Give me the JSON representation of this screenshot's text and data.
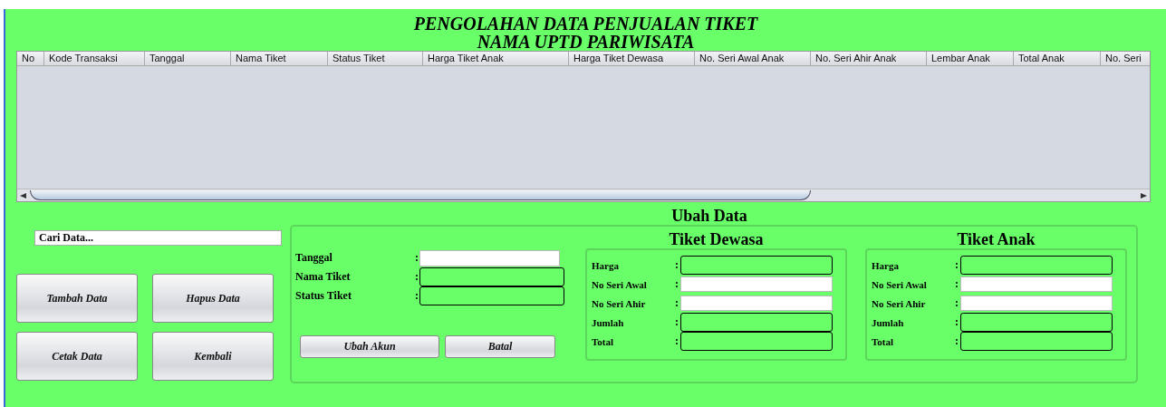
{
  "title_lines": [
    "PENGOLAHAN DATA PENJUALAN TIKET",
    "NAMA UPTD PARIWISATA"
  ],
  "table": {
    "columns": [
      "No",
      "Kode Transaksi",
      "Tanggal",
      "Nama Tiket",
      "Status Tiket",
      "Harga Tiket Anak",
      "Harga Tiket Dewasa",
      "No. Seri Awal Anak",
      "No. Seri Ahir Anak",
      "Lembar Anak",
      "Total Anak",
      "No. Seri"
    ]
  },
  "search": {
    "placeholder": "Cari Data..."
  },
  "actions": [
    "Tambah Data",
    "Hapus Data",
    "Cetak Data",
    "Kembali"
  ],
  "edit_panel": {
    "title": "Ubah Data",
    "fields": [
      {
        "label": "Tanggal",
        "sep": ":",
        "kind": "editable"
      },
      {
        "label": "Nama Tiket",
        "sep": ":",
        "kind": "display"
      },
      {
        "label": "Status Tiket",
        "sep": ":",
        "kind": "display"
      }
    ],
    "buttons": [
      "Ubah Akun",
      "Batal"
    ],
    "groups": [
      {
        "title": "Tiket Dewasa",
        "fields": [
          {
            "label": "Harga",
            "sep": ":",
            "kind": "display"
          },
          {
            "label": "No Seri Awal",
            "sep": ":",
            "kind": "editable"
          },
          {
            "label": "No Seri Ahir",
            "sep": ":",
            "kind": "editable"
          },
          {
            "label": "Jumlah",
            "sep": ":",
            "kind": "display"
          },
          {
            "label": "Total",
            "sep": ":",
            "kind": "display"
          }
        ]
      },
      {
        "title": "Tiket Anak",
        "fields": [
          {
            "label": "Harga",
            "sep": ":",
            "kind": "display"
          },
          {
            "label": "No Seri Awal",
            "sep": ":",
            "kind": "editable"
          },
          {
            "label": "No Seri Ahir",
            "sep": ":",
            "kind": "editable"
          },
          {
            "label": "Jumlah",
            "sep": ":",
            "kind": "display"
          },
          {
            "label": "Total",
            "sep": ":",
            "kind": "display"
          }
        ]
      }
    ]
  }
}
